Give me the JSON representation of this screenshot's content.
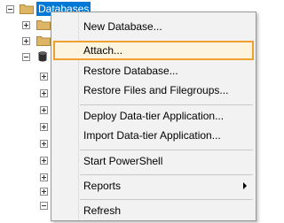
{
  "tree": {
    "root_label": "Databases",
    "colors": {
      "selection_bg": "#0078d7",
      "selection_text": "#ffffff",
      "folder": "#dcb567",
      "database": "#303030"
    }
  },
  "context_menu": {
    "items": [
      {
        "label": "New Database..."
      },
      {
        "label": "Attach..."
      },
      {
        "label": "Restore Database..."
      },
      {
        "label": "Restore Files and Filegroups..."
      },
      {
        "label": "Deploy Data-tier Application..."
      },
      {
        "label": "Import Data-tier Application..."
      },
      {
        "label": "Start PowerShell"
      },
      {
        "label": "Reports"
      },
      {
        "label": "Refresh"
      }
    ],
    "highlighted_item": "Attach...",
    "colors": {
      "background": "#f2f2f2",
      "border": "#979797",
      "highlight_border": "#f0a030",
      "highlight_bg": "#fdf4e0"
    }
  }
}
